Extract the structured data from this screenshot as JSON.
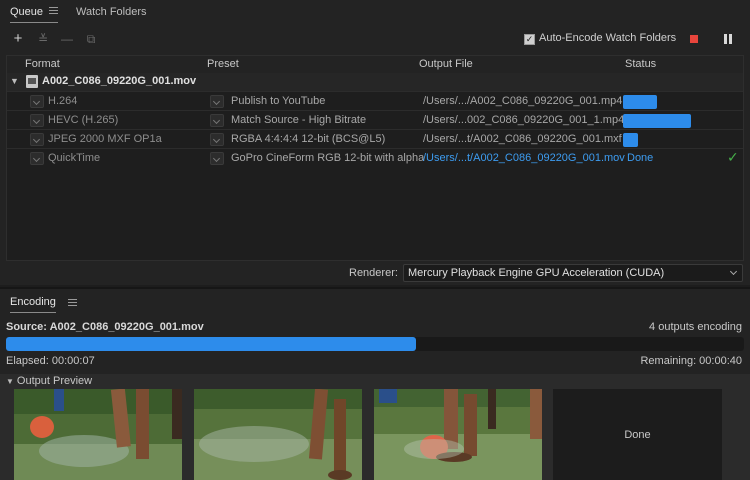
{
  "tabs": [
    {
      "label": "Queue",
      "active": true
    },
    {
      "label": "Watch Folders",
      "active": false
    }
  ],
  "toolbar": {
    "icons": [
      "add-icon",
      "settings-sliders-icon",
      "remove-icon",
      "duplicate-icon"
    ],
    "auto_encode_label": "Auto-Encode Watch Folders",
    "auto_encode_checked": true
  },
  "table": {
    "headers": {
      "format": "Format",
      "preset": "Preset",
      "output": "Output File",
      "status": "Status"
    },
    "group_name": "A002_C086_09220G_001.mov",
    "rows": [
      {
        "format": "H.264",
        "preset": "Publish to YouTube",
        "output": "/Users/.../A002_C086_09220G_001.mp4",
        "progress": 0.37,
        "status_text": "",
        "done": false
      },
      {
        "format": "HEVC (H.265)",
        "preset": "Match Source - High Bitrate",
        "output": "/Users/...002_C086_09220G_001_1.mp4",
        "progress": 0.74,
        "status_text": "",
        "done": false
      },
      {
        "format": "JPEG 2000 MXF OP1a",
        "preset": "RGBA 4:4:4:4 12-bit (BCS@L5)",
        "output": "/Users/...t/A002_C086_09220G_001.mxf",
        "progress": 0.16,
        "status_text": "",
        "done": false
      },
      {
        "format": "QuickTime",
        "preset": "GoPro CineForm RGB 12-bit with alpha",
        "output": "/Users/...t/A002_C086_09220G_001.mov",
        "progress": 1.0,
        "status_text": "Done",
        "done": true
      }
    ]
  },
  "renderer": {
    "label": "Renderer:",
    "value": "Mercury Playback Engine GPU Acceleration (CUDA)"
  },
  "encoding": {
    "tab_label": "Encoding",
    "source": "Source: A002_C086_09220G_001.mov",
    "outputs_count": "4 outputs encoding",
    "progress": 0.555,
    "elapsed": "Elapsed: 00:00:07",
    "remaining": "Remaining: 00:00:40",
    "preview_title": "Output Preview",
    "done_label": "Done"
  },
  "colors": {
    "accent": "#2d8ceb",
    "link": "#3d9cf0",
    "stop": "#e8453c",
    "done_check": "#46b04a"
  }
}
